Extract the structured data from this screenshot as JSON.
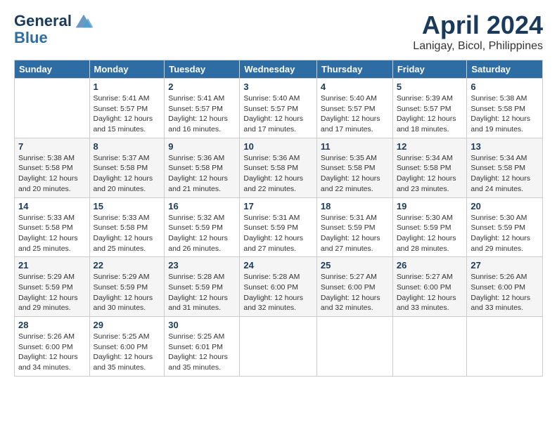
{
  "header": {
    "logo_line1": "General",
    "logo_line2": "Blue",
    "month_year": "April 2024",
    "location": "Lanigay, Bicol, Philippines"
  },
  "days_of_week": [
    "Sunday",
    "Monday",
    "Tuesday",
    "Wednesday",
    "Thursday",
    "Friday",
    "Saturday"
  ],
  "weeks": [
    [
      {
        "day": "",
        "sunrise": "",
        "sunset": "",
        "daylight": ""
      },
      {
        "day": "1",
        "sunrise": "Sunrise: 5:41 AM",
        "sunset": "Sunset: 5:57 PM",
        "daylight": "Daylight: 12 hours and 15 minutes."
      },
      {
        "day": "2",
        "sunrise": "Sunrise: 5:41 AM",
        "sunset": "Sunset: 5:57 PM",
        "daylight": "Daylight: 12 hours and 16 minutes."
      },
      {
        "day": "3",
        "sunrise": "Sunrise: 5:40 AM",
        "sunset": "Sunset: 5:57 PM",
        "daylight": "Daylight: 12 hours and 17 minutes."
      },
      {
        "day": "4",
        "sunrise": "Sunrise: 5:40 AM",
        "sunset": "Sunset: 5:57 PM",
        "daylight": "Daylight: 12 hours and 17 minutes."
      },
      {
        "day": "5",
        "sunrise": "Sunrise: 5:39 AM",
        "sunset": "Sunset: 5:57 PM",
        "daylight": "Daylight: 12 hours and 18 minutes."
      },
      {
        "day": "6",
        "sunrise": "Sunrise: 5:38 AM",
        "sunset": "Sunset: 5:58 PM",
        "daylight": "Daylight: 12 hours and 19 minutes."
      }
    ],
    [
      {
        "day": "7",
        "sunrise": "Sunrise: 5:38 AM",
        "sunset": "Sunset: 5:58 PM",
        "daylight": "Daylight: 12 hours and 20 minutes."
      },
      {
        "day": "8",
        "sunrise": "Sunrise: 5:37 AM",
        "sunset": "Sunset: 5:58 PM",
        "daylight": "Daylight: 12 hours and 20 minutes."
      },
      {
        "day": "9",
        "sunrise": "Sunrise: 5:36 AM",
        "sunset": "Sunset: 5:58 PM",
        "daylight": "Daylight: 12 hours and 21 minutes."
      },
      {
        "day": "10",
        "sunrise": "Sunrise: 5:36 AM",
        "sunset": "Sunset: 5:58 PM",
        "daylight": "Daylight: 12 hours and 22 minutes."
      },
      {
        "day": "11",
        "sunrise": "Sunrise: 5:35 AM",
        "sunset": "Sunset: 5:58 PM",
        "daylight": "Daylight: 12 hours and 22 minutes."
      },
      {
        "day": "12",
        "sunrise": "Sunrise: 5:34 AM",
        "sunset": "Sunset: 5:58 PM",
        "daylight": "Daylight: 12 hours and 23 minutes."
      },
      {
        "day": "13",
        "sunrise": "Sunrise: 5:34 AM",
        "sunset": "Sunset: 5:58 PM",
        "daylight": "Daylight: 12 hours and 24 minutes."
      }
    ],
    [
      {
        "day": "14",
        "sunrise": "Sunrise: 5:33 AM",
        "sunset": "Sunset: 5:58 PM",
        "daylight": "Daylight: 12 hours and 25 minutes."
      },
      {
        "day": "15",
        "sunrise": "Sunrise: 5:33 AM",
        "sunset": "Sunset: 5:58 PM",
        "daylight": "Daylight: 12 hours and 25 minutes."
      },
      {
        "day": "16",
        "sunrise": "Sunrise: 5:32 AM",
        "sunset": "Sunset: 5:59 PM",
        "daylight": "Daylight: 12 hours and 26 minutes."
      },
      {
        "day": "17",
        "sunrise": "Sunrise: 5:31 AM",
        "sunset": "Sunset: 5:59 PM",
        "daylight": "Daylight: 12 hours and 27 minutes."
      },
      {
        "day": "18",
        "sunrise": "Sunrise: 5:31 AM",
        "sunset": "Sunset: 5:59 PM",
        "daylight": "Daylight: 12 hours and 27 minutes."
      },
      {
        "day": "19",
        "sunrise": "Sunrise: 5:30 AM",
        "sunset": "Sunset: 5:59 PM",
        "daylight": "Daylight: 12 hours and 28 minutes."
      },
      {
        "day": "20",
        "sunrise": "Sunrise: 5:30 AM",
        "sunset": "Sunset: 5:59 PM",
        "daylight": "Daylight: 12 hours and 29 minutes."
      }
    ],
    [
      {
        "day": "21",
        "sunrise": "Sunrise: 5:29 AM",
        "sunset": "Sunset: 5:59 PM",
        "daylight": "Daylight: 12 hours and 29 minutes."
      },
      {
        "day": "22",
        "sunrise": "Sunrise: 5:29 AM",
        "sunset": "Sunset: 5:59 PM",
        "daylight": "Daylight: 12 hours and 30 minutes."
      },
      {
        "day": "23",
        "sunrise": "Sunrise: 5:28 AM",
        "sunset": "Sunset: 5:59 PM",
        "daylight": "Daylight: 12 hours and 31 minutes."
      },
      {
        "day": "24",
        "sunrise": "Sunrise: 5:28 AM",
        "sunset": "Sunset: 6:00 PM",
        "daylight": "Daylight: 12 hours and 32 minutes."
      },
      {
        "day": "25",
        "sunrise": "Sunrise: 5:27 AM",
        "sunset": "Sunset: 6:00 PM",
        "daylight": "Daylight: 12 hours and 32 minutes."
      },
      {
        "day": "26",
        "sunrise": "Sunrise: 5:27 AM",
        "sunset": "Sunset: 6:00 PM",
        "daylight": "Daylight: 12 hours and 33 minutes."
      },
      {
        "day": "27",
        "sunrise": "Sunrise: 5:26 AM",
        "sunset": "Sunset: 6:00 PM",
        "daylight": "Daylight: 12 hours and 33 minutes."
      }
    ],
    [
      {
        "day": "28",
        "sunrise": "Sunrise: 5:26 AM",
        "sunset": "Sunset: 6:00 PM",
        "daylight": "Daylight: 12 hours and 34 minutes."
      },
      {
        "day": "29",
        "sunrise": "Sunrise: 5:25 AM",
        "sunset": "Sunset: 6:00 PM",
        "daylight": "Daylight: 12 hours and 35 minutes."
      },
      {
        "day": "30",
        "sunrise": "Sunrise: 5:25 AM",
        "sunset": "Sunset: 6:01 PM",
        "daylight": "Daylight: 12 hours and 35 minutes."
      },
      {
        "day": "",
        "sunrise": "",
        "sunset": "",
        "daylight": ""
      },
      {
        "day": "",
        "sunrise": "",
        "sunset": "",
        "daylight": ""
      },
      {
        "day": "",
        "sunrise": "",
        "sunset": "",
        "daylight": ""
      },
      {
        "day": "",
        "sunrise": "",
        "sunset": "",
        "daylight": ""
      }
    ]
  ]
}
